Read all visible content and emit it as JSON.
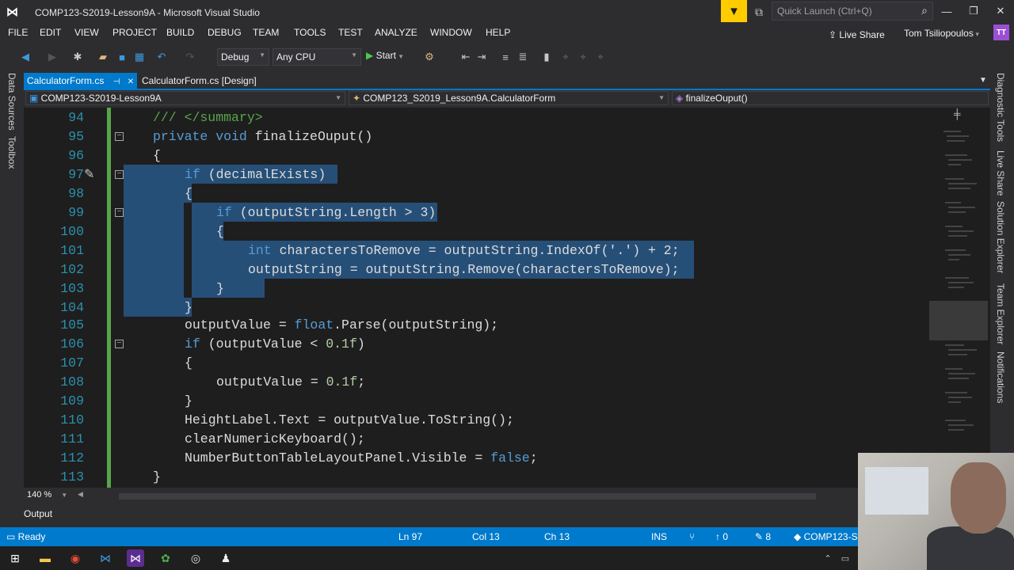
{
  "window": {
    "title": "COMP123-S2019-Lesson9A - Microsoft Visual Studio",
    "quick_launch_placeholder": "Quick Launch (Ctrl+Q)"
  },
  "menu": [
    "FILE",
    "EDIT",
    "VIEW",
    "PROJECT",
    "BUILD",
    "DEBUG",
    "TEAM",
    "TOOLS",
    "TEST",
    "ANALYZE",
    "WINDOW",
    "HELP"
  ],
  "header_right": {
    "live_share": "Live Share",
    "user_name": "Tom Tsiliopoulos",
    "user_initials": "TT"
  },
  "toolbar": {
    "config": "Debug",
    "platform": "Any CPU",
    "start_label": "Start"
  },
  "tabs": [
    {
      "label": "CalculatorForm.cs",
      "active": true
    },
    {
      "label": "CalculatorForm.cs [Design]",
      "active": false
    }
  ],
  "navbar": {
    "project": "COMP123-S2019-Lesson9A",
    "class": "COMP123_S2019_Lesson9A.CalculatorForm",
    "member": "finalizeOuput()"
  },
  "left_panel_tabs": [
    "Data Sources",
    "Toolbox"
  ],
  "right_panel_tabs": [
    "Diagnostic Tools",
    "Live Share",
    "Solution Explorer",
    "Team Explorer",
    "Notifications"
  ],
  "code": {
    "line_numbers": [
      "94",
      "95",
      "96",
      "97",
      "98",
      "99",
      "100",
      "101",
      "102",
      "103",
      "104",
      "105",
      "106",
      "107",
      "108",
      "109",
      "110",
      "111",
      "112",
      "113"
    ],
    "l94": "/// </summary>",
    "l95_kw1": "private",
    "l95_kw2": "void",
    "l95_rest": "finalizeOuput()",
    "l96": "{",
    "l97_kw": "if",
    "l97_rest": " (decimalExists)",
    "l98": "{",
    "l99_kw": "if",
    "l99_rest": " (outputString.Length > 3)",
    "l100": "{",
    "l101_kw": "int",
    "l101_rest": " charactersToRemove = outputString.IndexOf('.') + 2;",
    "l102": "outputString = outputString.Remove(charactersToRemove);",
    "l103": "}",
    "l104": "}",
    "l105_a": "outputValue = ",
    "l105_kw": "float",
    "l105_b": ".Parse(outputString);",
    "l106_kw": "if",
    "l106_a": " (outputValue < ",
    "l106_num": "0.1f",
    "l106_b": ")",
    "l107": "{",
    "l108_a": "outputValue = ",
    "l108_num": "0.1f",
    "l108_b": ";",
    "l109": "}",
    "l110": "HeightLabel.Text = outputValue.ToString();",
    "l111": "clearNumericKeyboard();",
    "l112_a": "NumberButtonTableLayoutPanel.Visible = ",
    "l112_kw": "false",
    "l112_b": ";",
    "l113": "}"
  },
  "zoom": "140 %",
  "output_tab": "Output",
  "status": {
    "ready": "Ready",
    "ln": "Ln 97",
    "col": "Col 13",
    "ch": "Ch 13",
    "ins": "INS",
    "up_count": "0",
    "pencil_count": "8",
    "repo": "COMP123-S"
  },
  "colors": {
    "accent": "#007acc",
    "editor_bg": "#1e1e1e",
    "selection": "#264f78",
    "keyword": "#569cd6",
    "comment": "#57a64a"
  }
}
